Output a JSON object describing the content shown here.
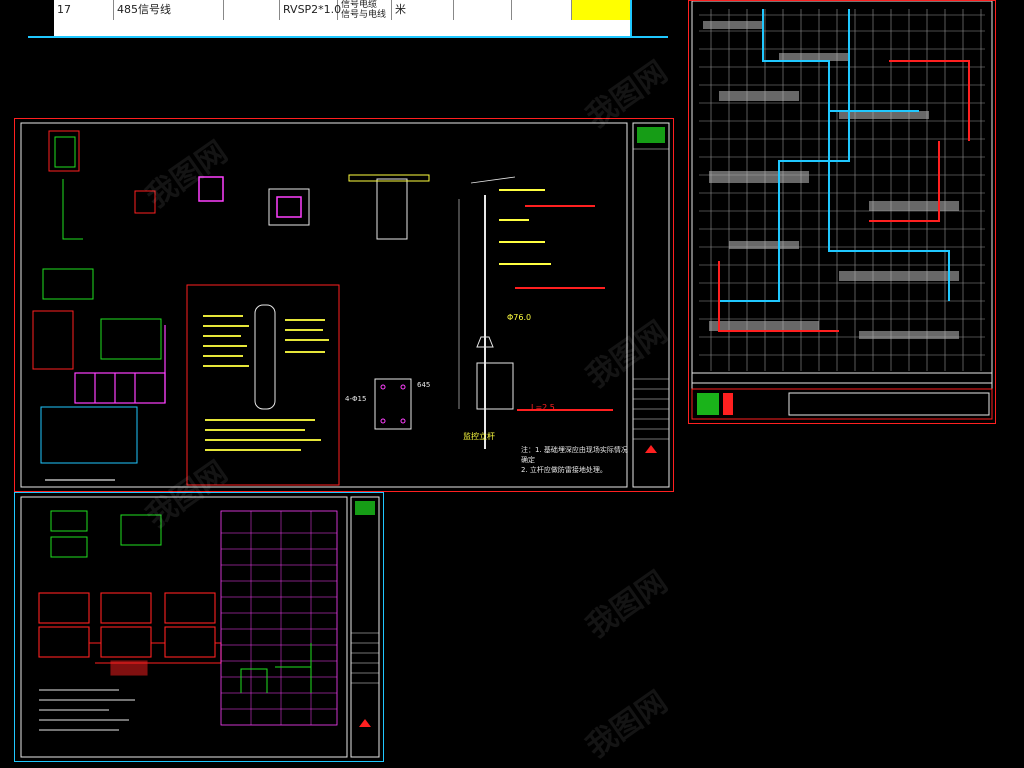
{
  "top_table": {
    "row_no": "17",
    "signal_line": "485信号线",
    "cable_spec": "RVSP2*1.0",
    "desc_line1": "信号电缆",
    "desc_line2": "信号与电线",
    "unit": "米"
  },
  "sheet_a": {
    "label_pole": "监控立杆",
    "label_note1": "注：1. 基础埋深应由现场实际情况确定",
    "label_note2": "2. 立杆应做防雷接地处理。",
    "dim_a": "Φ76.0",
    "dim_b": "L=2.5",
    "dim_c": "4-Φ15",
    "dim_d": "645"
  },
  "colors": {
    "frame_red": "#ff2020",
    "frame_cyan": "#20c8ff",
    "cad_green": "#20e020",
    "cad_yellow": "#ffff40",
    "cad_magenta": "#ff40ff",
    "cad_white": "#e8e8e8"
  },
  "watermark": "我图网"
}
